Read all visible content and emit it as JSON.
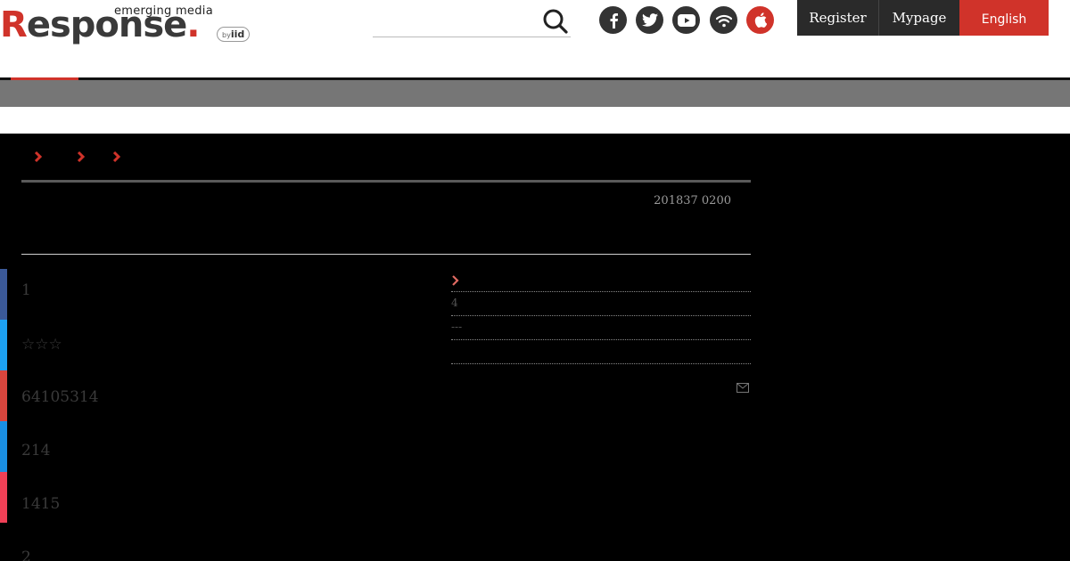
{
  "header": {
    "logo": {
      "tagline": "emerging media",
      "wordmark": "Response",
      "badge_by": "by",
      "badge_brand": "iid"
    },
    "search": {
      "placeholder": "",
      "icon": "search-icon"
    },
    "social_icons": [
      "facebook-icon",
      "twitter-icon",
      "youtube-icon",
      "rss-icon",
      "apple-icon"
    ],
    "buttons": {
      "register": "Register",
      "mypage": "Mypage",
      "english": "English"
    },
    "colors": {
      "accent": "#d0332a",
      "dark_button": "#2a2a2a",
      "graybar": "#767676"
    }
  },
  "article": {
    "date": "201837 0200",
    "breadcrumb_count": 3
  },
  "share": {
    "items": [
      {
        "service": "facebook",
        "color": "#3b5998",
        "count": "1"
      },
      {
        "service": "twitter",
        "color": "#1da1f2",
        "count": "☆☆☆"
      },
      {
        "service": "hatena",
        "color": "#d9453d",
        "count": "64105314"
      },
      {
        "service": "pocket-blue",
        "color": "#1a8fe3",
        "count": "214"
      },
      {
        "service": "pocket",
        "color": "#ef4056",
        "count": "1415"
      },
      {
        "service": "other",
        "color": "#000000",
        "count": "2"
      }
    ]
  },
  "related": {
    "items": [
      "",
      "4",
      "---",
      ""
    ]
  }
}
